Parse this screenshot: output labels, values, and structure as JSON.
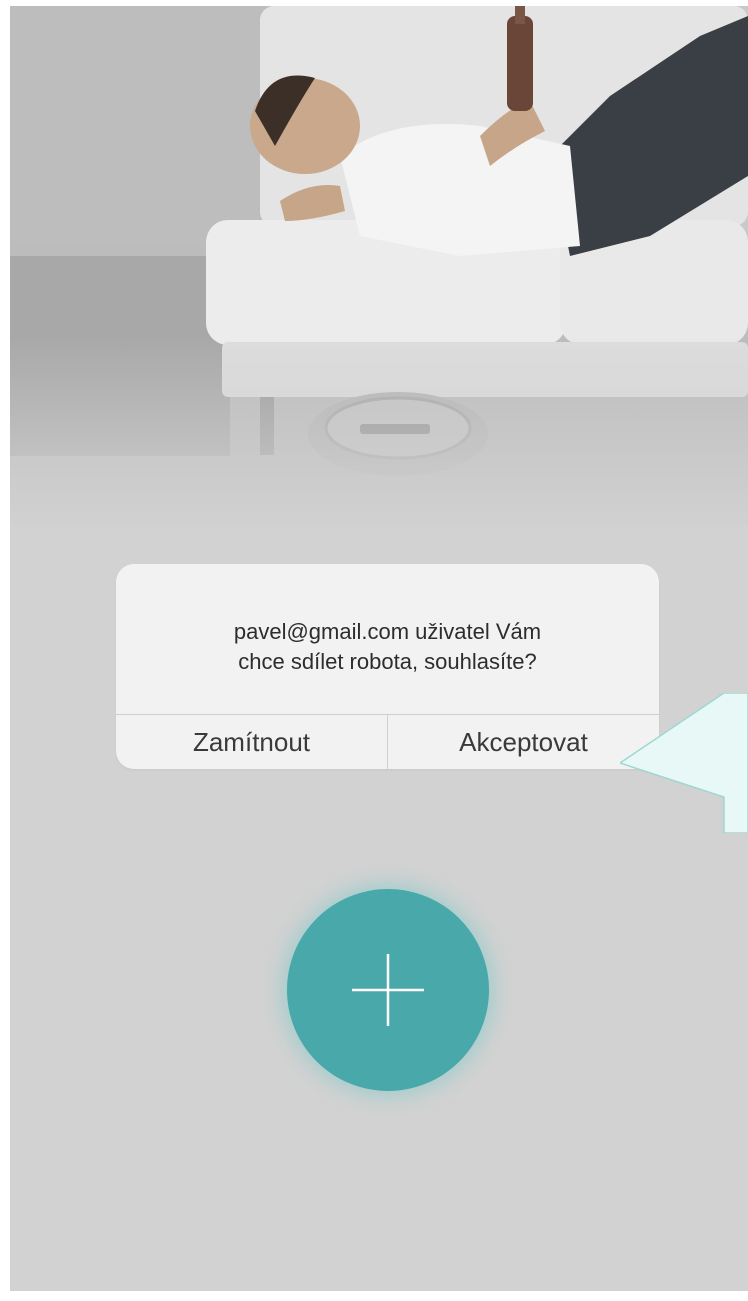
{
  "dialog": {
    "message_line1": "pavel@gmail.com uživatel Vám",
    "message_line2": "chce sdílet robota, souhlasíte?",
    "decline_label": "Zamítnout",
    "accept_label": "Akceptovat"
  },
  "fab": {
    "icon": "plus-icon",
    "color": "#48a8aa"
  },
  "callout": {
    "color": "#e8f8f6"
  },
  "background": {
    "color": "#d2d2d2"
  }
}
